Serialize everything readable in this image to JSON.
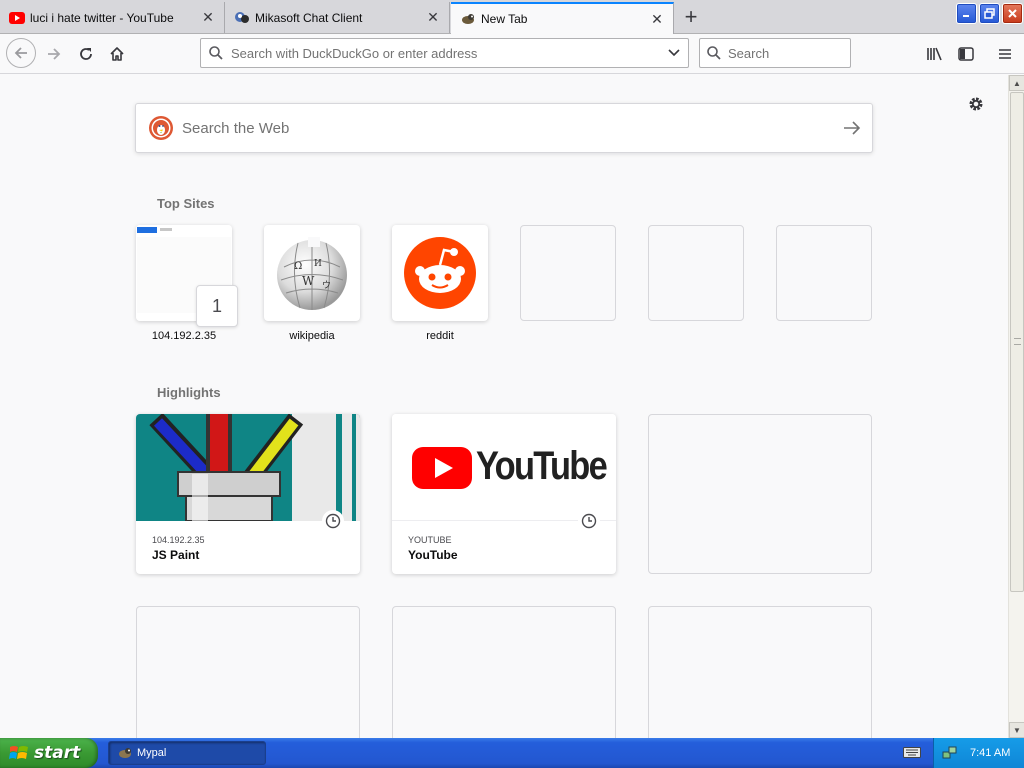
{
  "tabs": [
    {
      "title": "luci i hate twitter - YouTube",
      "icon": "youtube-icon",
      "selected": false
    },
    {
      "title": "Mikasoft Chat Client",
      "icon": "chat-client-icon",
      "selected": false
    },
    {
      "title": "New Tab",
      "icon": "mypal-icon",
      "selected": true
    }
  ],
  "navbar": {
    "url_placeholder": "Search with DuckDuckGo or enter address",
    "search_placeholder": "Search"
  },
  "newtab": {
    "web_search_placeholder": "Search the Web",
    "top_sites_title": "Top Sites",
    "highlights_title": "Highlights",
    "top_sites": [
      {
        "label": "104.192.2.35",
        "badge": "1",
        "icon": "site-thumbnail-icon"
      },
      {
        "label": "wikipedia",
        "icon": "wikipedia-globe-icon"
      },
      {
        "label": "reddit",
        "icon": "reddit-icon"
      }
    ],
    "highlights": [
      {
        "host": "104.192.2.35",
        "title": "JS Paint",
        "image": "paint-brushes-thumbnail"
      },
      {
        "host": "YOUTUBE",
        "title": "YouTube",
        "image": "youtube-logo-thumbnail"
      }
    ],
    "youtube_wordmark": "YouTube"
  },
  "taskbar": {
    "start_label": "start",
    "task_label": "Mypal",
    "clock": "7:41 AM"
  },
  "colors": {
    "accent": "#0a84ff",
    "reddit": "#ff4500",
    "youtube_red": "#ff0000",
    "xp_blue": "#245edb",
    "xp_green": "#3a9a33"
  }
}
